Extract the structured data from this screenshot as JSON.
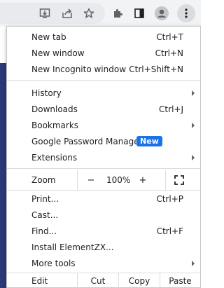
{
  "menu": {
    "section1": [
      {
        "label": "New tab",
        "shortcut": "Ctrl+T"
      },
      {
        "label": "New window",
        "shortcut": "Ctrl+N"
      },
      {
        "label": "New Incognito window",
        "shortcut": "Ctrl+Shift+N"
      }
    ],
    "section2": [
      {
        "label": "History",
        "submenu": true
      },
      {
        "label": "Downloads",
        "shortcut": "Ctrl+J"
      },
      {
        "label": "Bookmarks",
        "submenu": true
      },
      {
        "label": "Google Password Manager",
        "badge": "New"
      },
      {
        "label": "Extensions",
        "submenu": true
      }
    ],
    "zoom": {
      "label": "Zoom",
      "minus": "−",
      "value": "100%",
      "plus": "+"
    },
    "section3": [
      {
        "label": "Print...",
        "shortcut": "Ctrl+P"
      },
      {
        "label": "Cast..."
      },
      {
        "label": "Find...",
        "shortcut": "Ctrl+F"
      },
      {
        "label": "Install ElementZX..."
      },
      {
        "label": "More tools",
        "submenu": true
      }
    ],
    "edit": {
      "label": "Edit",
      "cut": "Cut",
      "copy": "Copy",
      "paste": "Paste"
    }
  },
  "toolbar": {
    "icons": [
      "install-icon",
      "share-icon",
      "star-icon",
      "extensions-icon",
      "side-panel-icon",
      "profile-icon",
      "more-menu-icon"
    ]
  },
  "colors": {
    "badge": "#1a73e8",
    "page_accent": "#2c3a78"
  }
}
